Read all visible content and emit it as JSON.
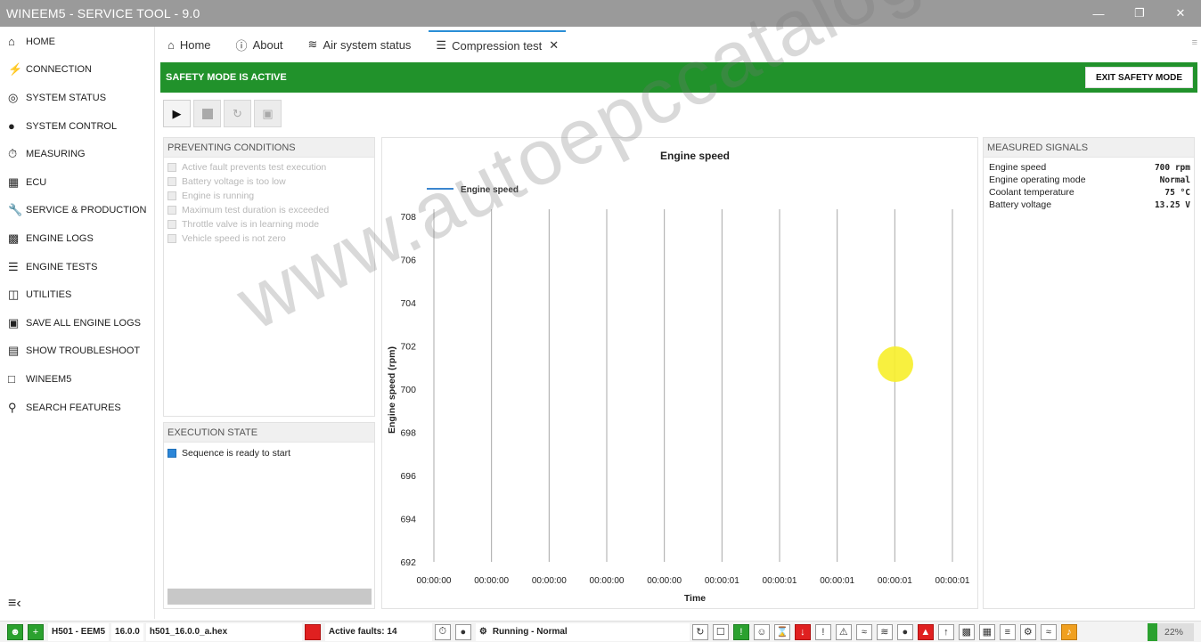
{
  "window": {
    "title": "WINEEM5 - SERVICE TOOL - 9.0"
  },
  "sidebar": {
    "items": [
      {
        "label": "HOME",
        "icon": "home-icon"
      },
      {
        "label": "CONNECTION",
        "icon": "plug-icon"
      },
      {
        "label": "SYSTEM STATUS",
        "icon": "gauge-icon"
      },
      {
        "label": "SYSTEM CONTROL",
        "icon": "toggle-icon"
      },
      {
        "label": "MEASURING",
        "icon": "stopwatch-icon"
      },
      {
        "label": "ECU",
        "icon": "chip-icon"
      },
      {
        "label": "SERVICE & PRODUCTION",
        "icon": "wrench-icon"
      },
      {
        "label": "ENGINE LOGS",
        "icon": "bar-chart-icon"
      },
      {
        "label": "ENGINE TESTS",
        "icon": "checklist-icon"
      },
      {
        "label": "UTILITIES",
        "icon": "toolbox-icon"
      },
      {
        "label": "SAVE ALL ENGINE LOGS",
        "icon": "save-icon"
      },
      {
        "label": "SHOW TROUBLESHOOT",
        "icon": "book-icon"
      },
      {
        "label": "WINEEM5",
        "icon": "window-icon"
      },
      {
        "label": "SEARCH FEATURES",
        "icon": "search-icon"
      }
    ]
  },
  "tabs": [
    {
      "label": "Home",
      "icon": "home-icon"
    },
    {
      "label": "About",
      "icon": "info-icon"
    },
    {
      "label": "Air system status",
      "icon": "wind-icon"
    },
    {
      "label": "Compression test",
      "icon": "checklist-icon",
      "active": true
    }
  ],
  "safety": {
    "label": "SAFETY MODE IS ACTIVE",
    "exit_label": "EXIT SAFETY MODE",
    "color": "#21922b"
  },
  "preventing": {
    "title": "PREVENTING CONDITIONS",
    "items": [
      "Active fault prevents test execution",
      "Battery voltage is too low",
      "Engine is running",
      "Maximum test duration is exceeded",
      "Throttle valve is in learning mode",
      "Vehicle speed is not zero"
    ]
  },
  "execution": {
    "title": "EXECUTION STATE",
    "state": "Sequence is ready to start"
  },
  "chart_data": {
    "type": "line",
    "title": "Engine speed",
    "xlabel": "Time",
    "ylabel": "Engine speed (rpm)",
    "ylim": [
      692,
      708
    ],
    "yticks": [
      692,
      694,
      696,
      698,
      700,
      702,
      704,
      706,
      708
    ],
    "x": [
      "00:00:00",
      "00:00:00",
      "00:00:00",
      "00:00:00",
      "00:00:00",
      "00:00:01",
      "00:00:01",
      "00:00:01",
      "00:00:01",
      "00:00:01"
    ],
    "series": [
      {
        "name": "Engine speed",
        "values": [],
        "color": "#3b86cf"
      }
    ],
    "legend": "top-left",
    "grid": "vertical"
  },
  "signals": {
    "title": "MEASURED SIGNALS",
    "items": [
      {
        "name": "Engine speed",
        "value": "700 rpm"
      },
      {
        "name": "Engine operating mode",
        "value": "Normal"
      },
      {
        "name": "Coolant temperature",
        "value": "75 °C"
      },
      {
        "name": "Battery voltage",
        "value": "13.25 V"
      }
    ]
  },
  "statusbar": {
    "ecu": "H501 - EEM5",
    "version": "16.0.0",
    "file": "h501_16.0.0_a.hex",
    "faults": "Active faults: 14",
    "engine_state": "Running - Normal",
    "percent": "22%"
  },
  "watermark": "www.autoepccatalog.com"
}
